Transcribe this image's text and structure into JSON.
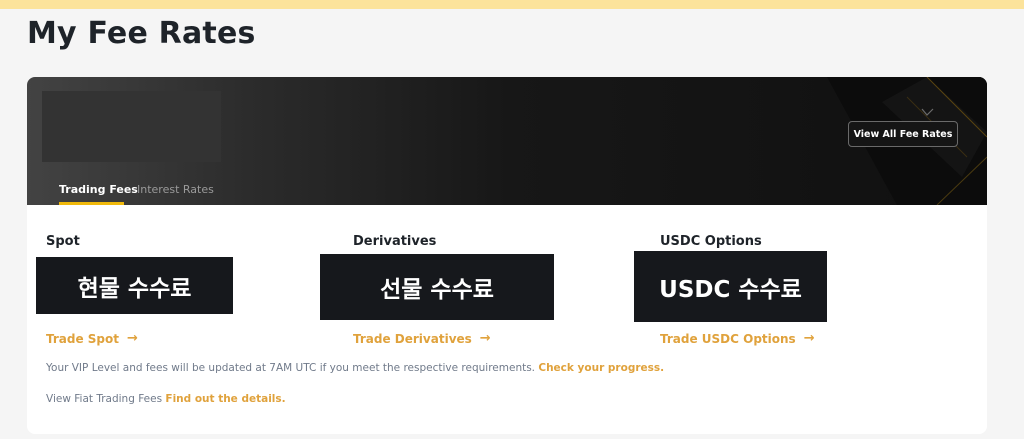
{
  "header": {
    "title": "My Fee Rates"
  },
  "banner": {
    "view_all_label": "View All Fee Rates",
    "tabs": [
      {
        "label": "Trading Fees",
        "active": true
      },
      {
        "label": "Interest Rates",
        "active": false
      }
    ]
  },
  "sections": [
    {
      "title": "Spot",
      "redaction_text": "현물 수수료",
      "link_label": "Trade Spot"
    },
    {
      "title": "Derivatives",
      "redaction_text": "선물 수수료",
      "link_label": "Trade Derivatives"
    },
    {
      "title": "USDC Options",
      "redaction_text": "USDC 수수료",
      "link_label": "Trade USDC Options"
    }
  ],
  "notes": {
    "vip_text": "Your VIP Level and fees will be updated at 7AM UTC if you meet the respective requirements.",
    "vip_link": "Check your progress.",
    "fiat_text": "View Fiat Trading Fees",
    "fiat_link": "Find out the details."
  },
  "colors": {
    "accent": "#f0b90b",
    "link": "#e0a23c",
    "top_strip": "#fce39b"
  },
  "icons": {
    "arrow": "arrow-right-icon"
  }
}
